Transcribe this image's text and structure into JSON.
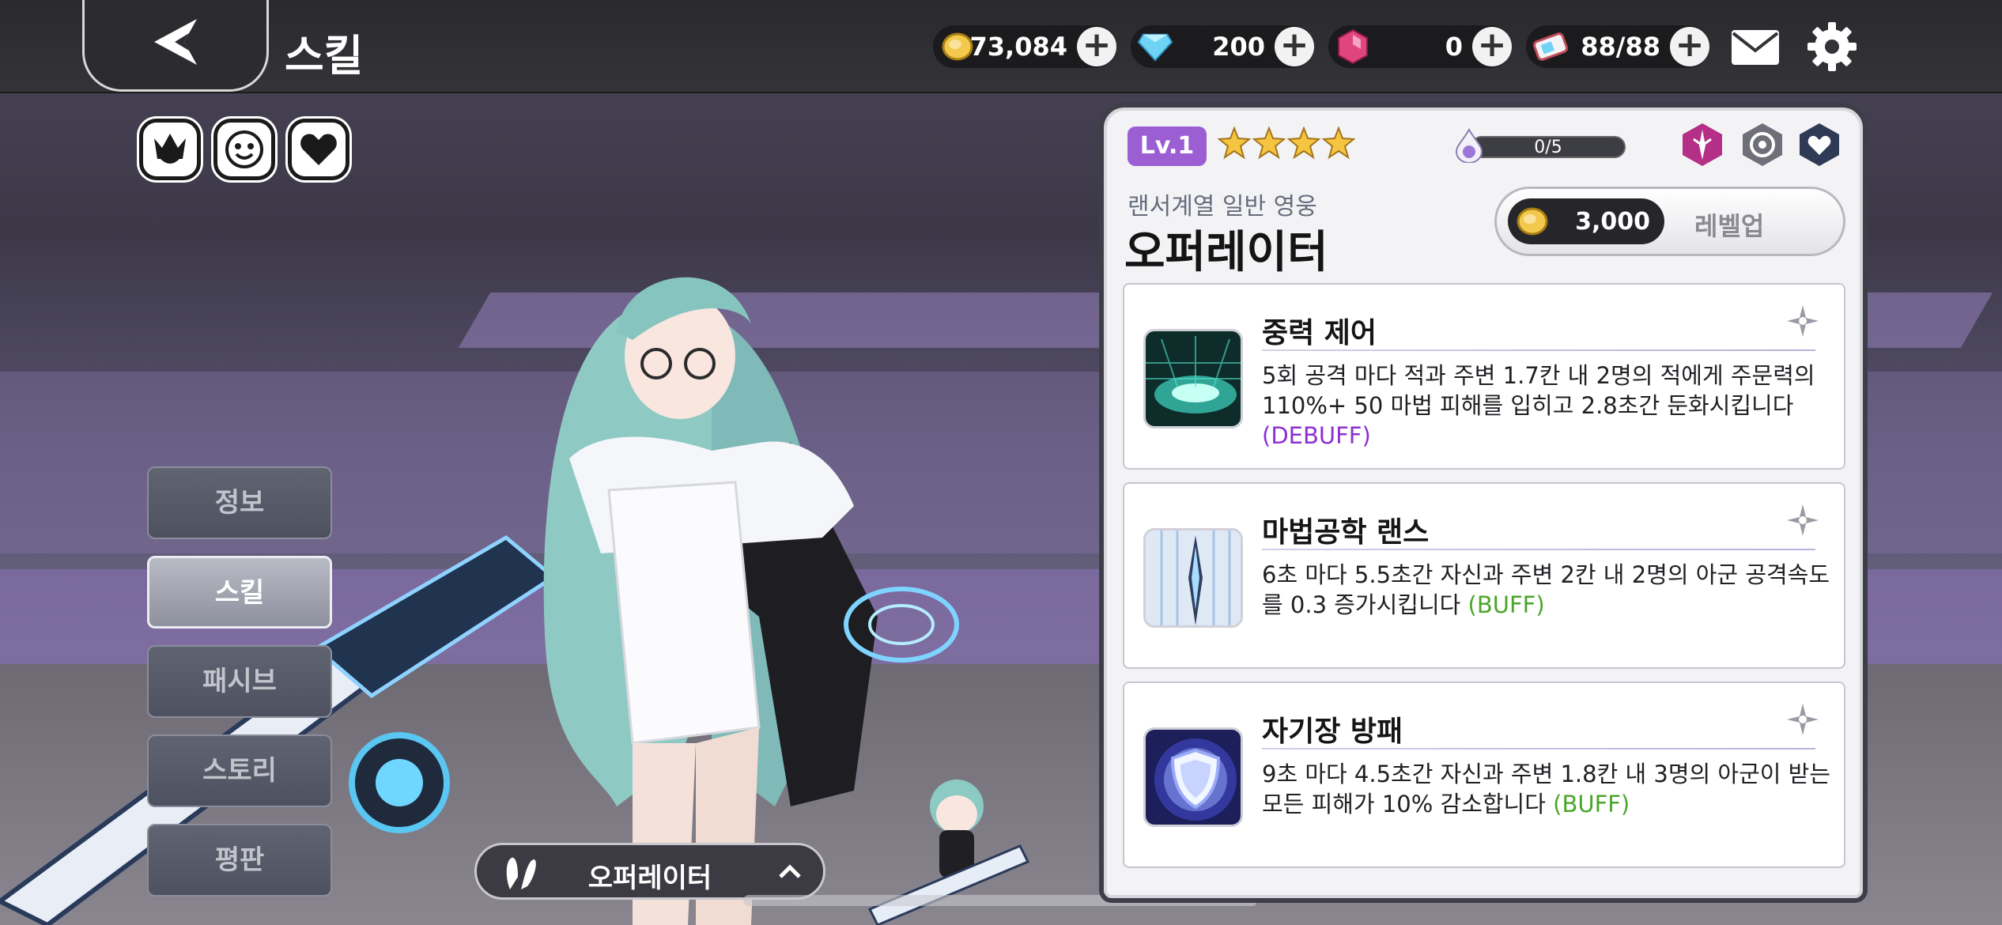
{
  "screen": {
    "title": "스킬"
  },
  "currencies": [
    {
      "name": "gold",
      "amount": "73,084",
      "color": "#f2c94c"
    },
    {
      "name": "diamond",
      "amount": "200",
      "color": "#6fd3f5"
    },
    {
      "name": "ruby",
      "amount": "0",
      "color": "#e0457b"
    },
    {
      "name": "stamina",
      "amount": "88/88",
      "color": "#c14a5a"
    }
  ],
  "side_menu": [
    {
      "label": "정보",
      "active": false
    },
    {
      "label": "스킬",
      "active": true
    },
    {
      "label": "패시브",
      "active": false
    },
    {
      "label": "스토리",
      "active": false
    },
    {
      "label": "평판",
      "active": false
    }
  ],
  "character": {
    "selected_name": "오퍼레이터"
  },
  "hero": {
    "level": "Lv.1",
    "stars": 4,
    "exp": "0/5",
    "subtitle": "랜서계열 일반 영웅",
    "name": "오퍼레이터",
    "levelup_cost": "3,000",
    "levelup_label": "레벨업"
  },
  "skills": [
    {
      "name": "중력 제어",
      "desc": "5회 공격 마다 적과 주변 1.7칸 내 2명의 적에게 주문력의 110%+ 50 마법 피해를 입히고 2.8초간 둔화시킵니다",
      "tag": "(DEBUFF)",
      "icon": "gravity-icon"
    },
    {
      "name": "마법공학 랜스",
      "desc": "6초 마다 5.5초간 자신과 주변 2칸 내 2명의 아군 공격속도를 0.3 증가시킵니다",
      "tag": "(BUFF)",
      "icon": "lance-icon"
    },
    {
      "name": "자기장 방패",
      "desc": "9초 마다 4.5초간 자신과 주변 1.8칸 내 3명의 아군이 받는 모든 피해가 10% 감소합니다",
      "tag": "(BUFF)",
      "icon": "shield-icon"
    }
  ],
  "colors": {
    "accent_purple": "#9b5fd3",
    "debuff": "#8e2fd0",
    "buff": "#4aa62a"
  }
}
